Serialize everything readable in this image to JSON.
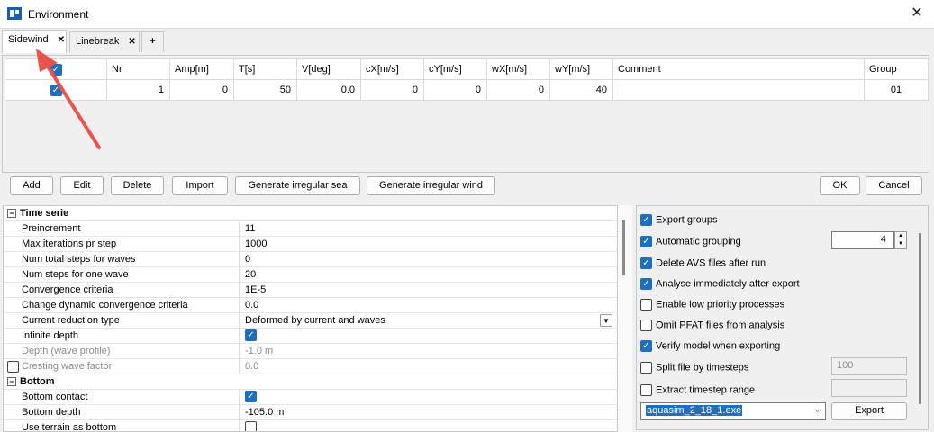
{
  "window": {
    "title": "Environment"
  },
  "tabs": [
    {
      "label": "Sidewind"
    },
    {
      "label": "Linebreak"
    },
    {
      "label": "+"
    }
  ],
  "grid": {
    "columns": [
      "",
      "Nr",
      "Amp[m]",
      "T[s]",
      "V[deg]",
      "cX[m/s]",
      "cY[m/s]",
      "wX[m/s]",
      "wY[m/s]",
      "Comment",
      "Group"
    ],
    "rows": [
      {
        "checked": true,
        "cells": [
          "1",
          "0",
          "50",
          "0.0",
          "0",
          "0",
          "0",
          "40",
          "",
          "01"
        ]
      }
    ]
  },
  "buttons": {
    "add": "Add",
    "edit": "Edit",
    "delete": "Delete",
    "import": "Import",
    "irregular_sea": "Generate irregular sea",
    "irregular_wind": "Generate irregular wind",
    "ok": "OK",
    "cancel": "Cancel",
    "export": "Export"
  },
  "properties": {
    "time_serie": "Time serie",
    "preincrement": {
      "name": "Preincrement",
      "value": "11"
    },
    "max_iter": {
      "name": "Max iterations pr step",
      "value": "1000"
    },
    "steps_waves": {
      "name": "Num total steps for waves",
      "value": "0"
    },
    "steps_one_wave": {
      "name": "Num steps for one wave",
      "value": "20"
    },
    "convergence": {
      "name": "Convergence criteria",
      "value": "1E-5"
    },
    "dyn_convergence": {
      "name": "Change dynamic convergence criteria",
      "value": "0.0"
    },
    "current_reduction": {
      "name": "Current reduction type",
      "value": "Deformed by current and waves"
    },
    "infinite_depth": {
      "name": "Infinite depth"
    },
    "depth_profile": {
      "name": "Depth (wave profile)",
      "value": "-1.0 m"
    },
    "cresting": {
      "name": "Cresting wave factor",
      "value": "0.0"
    },
    "bottom": "Bottom",
    "bottom_contact": {
      "name": "Bottom contact"
    },
    "bottom_depth": {
      "name": "Bottom depth",
      "value": "-105.0 m"
    },
    "terrain": {
      "name": "Use terrain as bottom"
    }
  },
  "options": {
    "export_groups": "Export groups",
    "auto_grouping": "Automatic grouping",
    "auto_grouping_value": "4",
    "delete_avs": "Delete AVS files after run",
    "analyse": "Analyse immediately after export",
    "low_priority": "Enable low priority processes",
    "omit_pfat": "Omit PFAT files from analysis",
    "verify": "Verify model when exporting",
    "split": "Split file by timesteps",
    "split_value": "100",
    "extract": "Extract timestep range",
    "exe": "aquasim_2_18_1.exe"
  }
}
